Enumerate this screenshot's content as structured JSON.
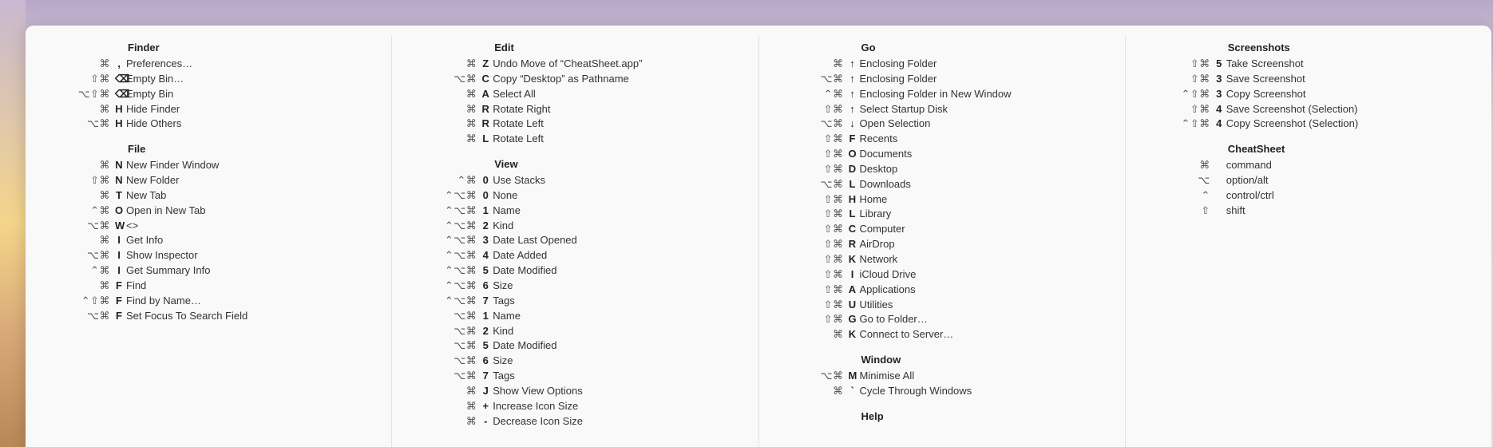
{
  "columns": [
    {
      "sections": [
        {
          "title": "Finder",
          "items": [
            {
              "shortcut": "⌘",
              "key": ",",
              "label": "Preferences…"
            },
            {
              "shortcut": "⇧⌘",
              "key": "⌫",
              "label": "Empty Bin…"
            },
            {
              "shortcut": "⌥⇧⌘",
              "key": "⌫",
              "label": "Empty Bin"
            },
            {
              "shortcut": "⌘",
              "key": "H",
              "label": "Hide Finder"
            },
            {
              "shortcut": "⌥⌘",
              "key": "H",
              "label": "Hide Others"
            }
          ]
        },
        {
          "title": "File",
          "items": [
            {
              "shortcut": "⌘",
              "key": "N",
              "label": "New Finder Window"
            },
            {
              "shortcut": "⇧⌘",
              "key": "N",
              "label": "New Folder"
            },
            {
              "shortcut": "⌘",
              "key": "T",
              "label": "New Tab"
            },
            {
              "shortcut": "⌃⌘",
              "key": "O",
              "label": "Open in New Tab"
            },
            {
              "shortcut": "⌥⌘",
              "key": "W",
              "label": "<>"
            },
            {
              "shortcut": "⌘",
              "key": "I",
              "label": "Get Info"
            },
            {
              "shortcut": "⌥⌘",
              "key": "I",
              "label": "Show Inspector"
            },
            {
              "shortcut": "⌃⌘",
              "key": "I",
              "label": "Get Summary Info"
            },
            {
              "shortcut": "⌘",
              "key": "F",
              "label": "Find"
            },
            {
              "shortcut": "⌃⇧⌘",
              "key": "F",
              "label": "Find by Name…"
            },
            {
              "shortcut": "⌥⌘",
              "key": "F",
              "label": "Set Focus To Search Field"
            }
          ]
        }
      ]
    },
    {
      "sections": [
        {
          "title": "Edit",
          "items": [
            {
              "shortcut": "⌘",
              "key": "Z",
              "label": "Undo Move of “CheatSheet.app”"
            },
            {
              "shortcut": "⌥⌘",
              "key": "C",
              "label": "Copy “Desktop” as Pathname"
            },
            {
              "shortcut": "⌘",
              "key": "A",
              "label": "Select All"
            },
            {
              "shortcut": "⌘",
              "key": "R",
              "label": "Rotate Right"
            },
            {
              "shortcut": "⌘",
              "key": "R",
              "label": "Rotate Left"
            },
            {
              "shortcut": "⌘",
              "key": "L",
              "label": "Rotate Left"
            }
          ]
        },
        {
          "title": "View",
          "items": [
            {
              "shortcut": "⌃⌘",
              "key": "0",
              "label": "Use Stacks"
            },
            {
              "shortcut": "⌃⌥⌘",
              "key": "0",
              "label": "None"
            },
            {
              "shortcut": "⌃⌥⌘",
              "key": "1",
              "label": "Name"
            },
            {
              "shortcut": "⌃⌥⌘",
              "key": "2",
              "label": "Kind"
            },
            {
              "shortcut": "⌃⌥⌘",
              "key": "3",
              "label": "Date Last Opened"
            },
            {
              "shortcut": "⌃⌥⌘",
              "key": "4",
              "label": "Date Added"
            },
            {
              "shortcut": "⌃⌥⌘",
              "key": "5",
              "label": "Date Modified"
            },
            {
              "shortcut": "⌃⌥⌘",
              "key": "6",
              "label": "Size"
            },
            {
              "shortcut": "⌃⌥⌘",
              "key": "7",
              "label": "Tags"
            },
            {
              "shortcut": "⌥⌘",
              "key": "1",
              "label": "Name"
            },
            {
              "shortcut": "⌥⌘",
              "key": "2",
              "label": "Kind"
            },
            {
              "shortcut": "⌥⌘",
              "key": "5",
              "label": "Date Modified"
            },
            {
              "shortcut": "⌥⌘",
              "key": "6",
              "label": "Size"
            },
            {
              "shortcut": "⌥⌘",
              "key": "7",
              "label": "Tags"
            },
            {
              "shortcut": "⌘",
              "key": "J",
              "label": "Show View Options"
            },
            {
              "shortcut": "⌘",
              "key": "+",
              "label": "Increase Icon Size"
            },
            {
              "shortcut": "⌘",
              "key": "-",
              "label": "Decrease Icon Size"
            }
          ]
        }
      ]
    },
    {
      "sections": [
        {
          "title": "Go",
          "items": [
            {
              "shortcut": "⌘",
              "key": "↑",
              "label": "Enclosing Folder"
            },
            {
              "shortcut": "⌥⌘",
              "key": "↑",
              "label": "Enclosing Folder"
            },
            {
              "shortcut": "⌃⌘",
              "key": "↑",
              "label": "Enclosing Folder in New Window"
            },
            {
              "shortcut": "⇧⌘",
              "key": "↑",
              "label": "Select Startup Disk"
            },
            {
              "shortcut": "⌥⌘",
              "key": "↓",
              "label": "Open Selection"
            },
            {
              "shortcut": "⇧⌘",
              "key": "F",
              "label": "Recents"
            },
            {
              "shortcut": "⇧⌘",
              "key": "O",
              "label": "Documents"
            },
            {
              "shortcut": "⇧⌘",
              "key": "D",
              "label": "Desktop"
            },
            {
              "shortcut": "⌥⌘",
              "key": "L",
              "label": "Downloads"
            },
            {
              "shortcut": "⇧⌘",
              "key": "H",
              "label": "Home"
            },
            {
              "shortcut": "⇧⌘",
              "key": "L",
              "label": "Library"
            },
            {
              "shortcut": "⇧⌘",
              "key": "C",
              "label": "Computer"
            },
            {
              "shortcut": "⇧⌘",
              "key": "R",
              "label": "AirDrop"
            },
            {
              "shortcut": "⇧⌘",
              "key": "K",
              "label": "Network"
            },
            {
              "shortcut": "⇧⌘",
              "key": "I",
              "label": "iCloud Drive"
            },
            {
              "shortcut": "⇧⌘",
              "key": "A",
              "label": "Applications"
            },
            {
              "shortcut": "⇧⌘",
              "key": "U",
              "label": "Utilities"
            },
            {
              "shortcut": "⇧⌘",
              "key": "G",
              "label": "Go to Folder…"
            },
            {
              "shortcut": "⌘",
              "key": "K",
              "label": "Connect to Server…"
            }
          ]
        },
        {
          "title": "Window",
          "items": [
            {
              "shortcut": "⌥⌘",
              "key": "M",
              "label": "Minimise All"
            },
            {
              "shortcut": "⌘",
              "key": "`",
              "label": "Cycle Through Windows"
            }
          ]
        },
        {
          "title": "Help",
          "items": []
        }
      ]
    },
    {
      "sections": [
        {
          "title": "Screenshots",
          "items": [
            {
              "shortcut": "⇧⌘",
              "key": "5",
              "label": "Take Screenshot"
            },
            {
              "shortcut": "⇧⌘",
              "key": "3",
              "label": "Save Screenshot"
            },
            {
              "shortcut": "⌃⇧⌘",
              "key": "3",
              "label": "Copy Screenshot"
            },
            {
              "shortcut": "⇧⌘",
              "key": "4",
              "label": "Save Screenshot (Selection)"
            },
            {
              "shortcut": "⌃⇧⌘",
              "key": "4",
              "label": "Copy Screenshot (Selection)"
            }
          ]
        },
        {
          "title": "CheatSheet",
          "items": [
            {
              "shortcut": "⌘",
              "key": "",
              "label": "command"
            },
            {
              "shortcut": "⌥",
              "key": "",
              "label": "option/alt"
            },
            {
              "shortcut": "⌃",
              "key": "",
              "label": "control/ctrl"
            },
            {
              "shortcut": "⇧",
              "key": "",
              "label": "shift"
            }
          ]
        }
      ]
    }
  ]
}
